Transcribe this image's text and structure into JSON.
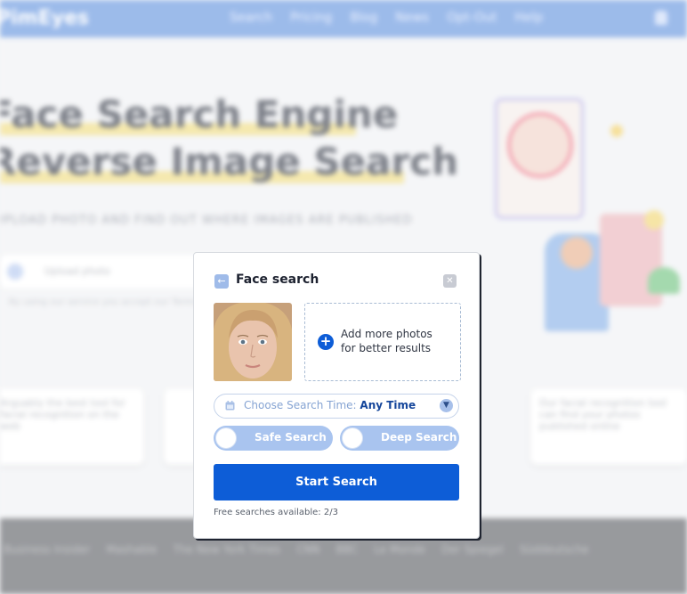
{
  "background": {
    "logo": "PimEyes",
    "menu": [
      "Search",
      "Pricing",
      "Blog",
      "News",
      "Opt-Out",
      "Help"
    ],
    "hero_line1": "Face Search Engine",
    "hero_line2": "Reverse Image Search",
    "subtitle": "UPLOAD PHOTO AND FIND OUT WHERE IMAGES ARE PUBLISHED",
    "search_placeholder": "Upload photo",
    "fine_print": "By using our service you accept our Terms of Service and Privacy Policy",
    "card1": "Arguably the best tool for facial recognition on the web",
    "card3": "Our facial recognition tool can find your photos published online",
    "footer_items": [
      "Business Insider",
      "Mashable",
      "The New York Times",
      "CNN",
      "BBC",
      "Le Monde",
      "Der Spiegel",
      "Süddeutsche"
    ]
  },
  "modal": {
    "title": "Face search",
    "add_photos_text": "Add more photos for better results",
    "search_time_label": "Choose Search Time:",
    "search_time_value": "Any Time",
    "safe_search_label": "Safe Search",
    "deep_search_label": "Deep Search",
    "start_button": "Start Search",
    "free_searches_label": "Free searches available:",
    "free_searches_count": "2/3"
  },
  "colors": {
    "accent": "#0d5dd7",
    "toggle_bg": "#a9c4ef",
    "nav_bg": "#8fb2e8"
  }
}
